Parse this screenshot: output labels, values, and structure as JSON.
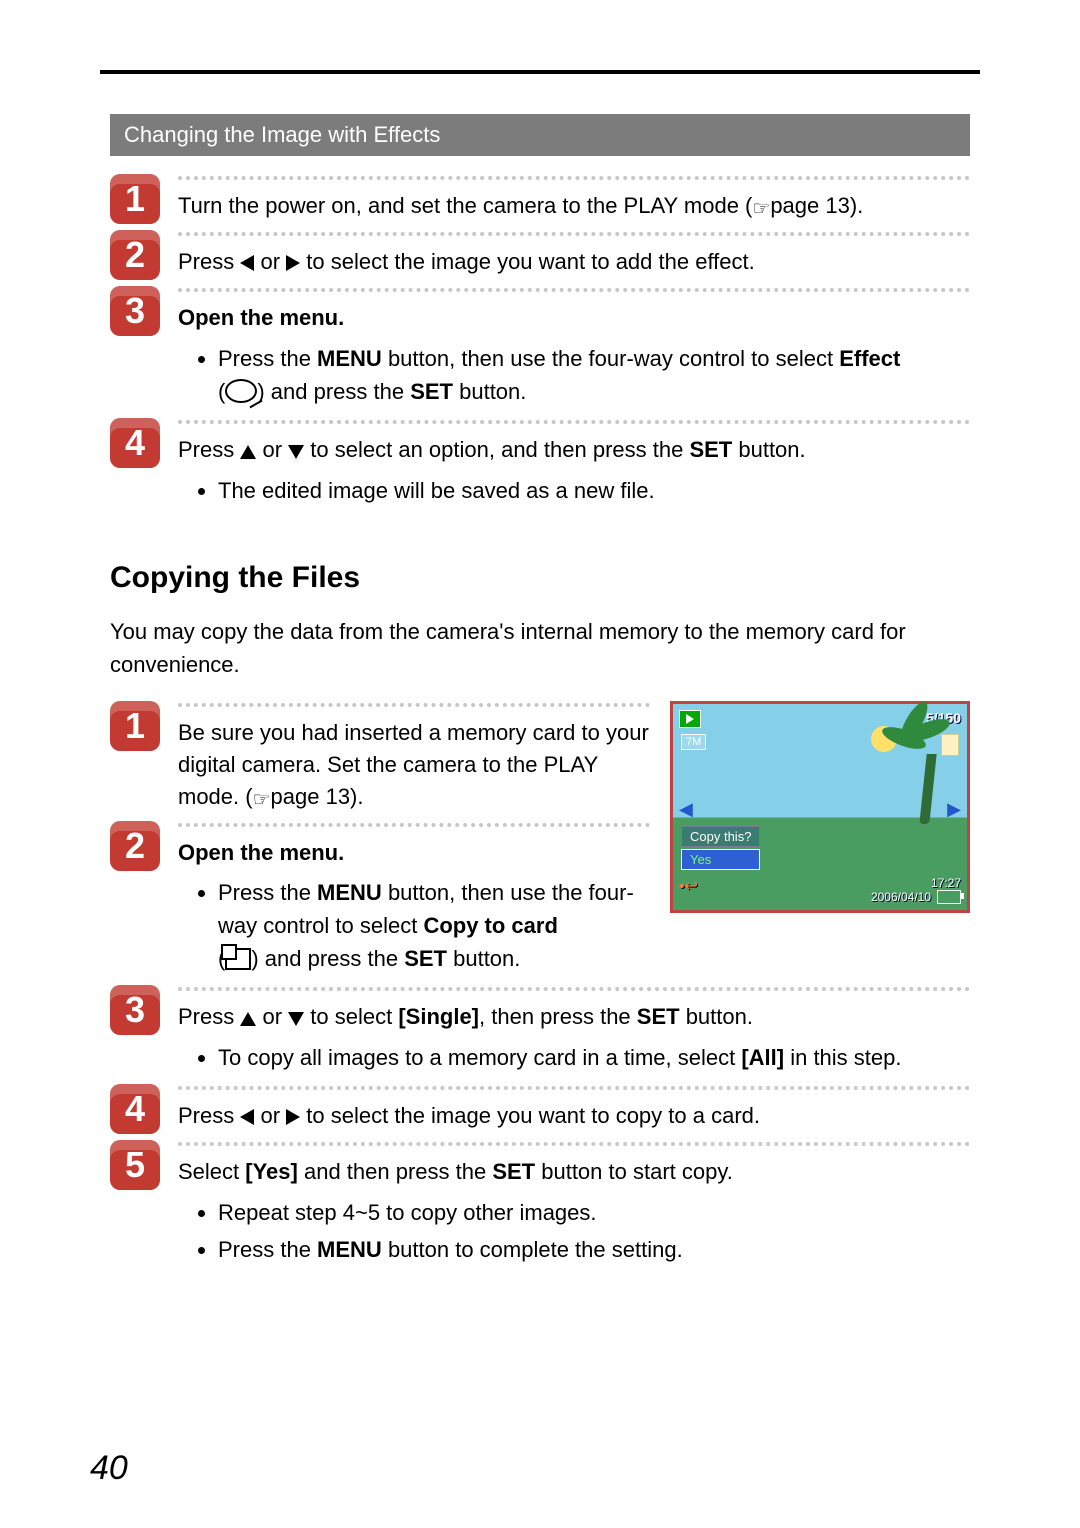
{
  "page_number": "40",
  "section1": {
    "title": "Changing the Image with Effects",
    "steps": {
      "s1": {
        "num": "1",
        "text_a": "Turn the power on, and set the camera to the PLAY mode (",
        "text_b": "page 13)."
      },
      "s2": {
        "num": "2",
        "text_a": "Press ",
        "text_mid": " or ",
        "text_b": " to select the image you want to add the effect."
      },
      "s3": {
        "num": "3",
        "lead": "Open the menu.",
        "b1_a": "Press the ",
        "menu": "MENU",
        "b1_b": " button, then use the four-way control to select ",
        "effect": "Effect",
        "b2_a": "(",
        "b2_b": ") and press the ",
        "set": "SET",
        "b2_c": " button."
      },
      "s4": {
        "num": "4",
        "text_a": "Press ",
        "text_mid": " or ",
        "text_b": " to select an option, and then press the ",
        "set": "SET",
        "text_c": " button.",
        "bullet": "The edited image will be saved as a new file."
      }
    }
  },
  "section2": {
    "heading": "Copying the Files",
    "intro": "You may copy the data from the camera's internal memory to the memory card for convenience.",
    "steps": {
      "s1": {
        "num": "1",
        "a": "Be sure you had inserted a memory card to your digital camera. Set the camera to the PLAY mode. (",
        "b": "page 13)."
      },
      "s2": {
        "num": "2",
        "lead": "Open the menu.",
        "b1_a": "Press the ",
        "menu": "MENU",
        "b1_b": " button, then use the four-way control to select ",
        "copy": "Copy to card",
        "b2_a": " (",
        "b2_b": ") and press the ",
        "set": "SET",
        "b2_c": " button."
      },
      "s3": {
        "num": "3",
        "a": "Press ",
        "mid": " or ",
        "b": " to select ",
        "single": "[Single]",
        "c": ", then press the ",
        "set": "SET",
        "d": " button.",
        "bullet_a": "To copy all images to a memory card in a time, select ",
        "all": "[All]",
        "bullet_b": " in this step."
      },
      "s4": {
        "num": "4",
        "a": "Press ",
        "mid": " or ",
        "b": " to select the image you want to copy to a card."
      },
      "s5": {
        "num": "5",
        "a": "Select ",
        "yes": "[Yes]",
        "b": " and then press the ",
        "set": "SET",
        "c": " button to start copy.",
        "bul1": "Repeat step 4~5 to copy other images.",
        "bul2_a": "Press the ",
        "menu": "MENU",
        "bul2_b": " button to complete the setting."
      }
    }
  },
  "lcd": {
    "count": "5/150",
    "res": "7M",
    "question": "Copy this?",
    "answer": "Yes",
    "time": "17:27",
    "date": "2006/04/10"
  }
}
